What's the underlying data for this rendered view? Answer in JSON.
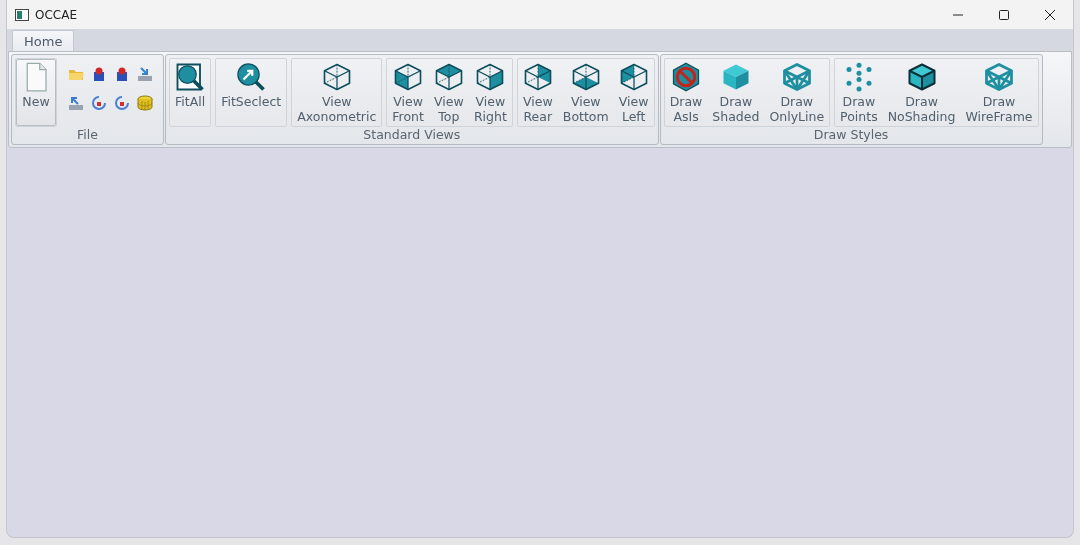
{
  "window": {
    "title": "OCCAE"
  },
  "tabs": [
    {
      "label": "Home",
      "selected": true
    }
  ],
  "ribbon": {
    "groups": [
      {
        "label": "File",
        "panels": [
          [
            {
              "kind": "large",
              "label": "New"
            }
          ],
          [
            {
              "kind": "small"
            },
            {
              "kind": "small"
            },
            {
              "kind": "small"
            },
            {
              "kind": "small"
            },
            {
              "kind": "small"
            },
            {
              "kind": "small"
            },
            {
              "kind": "small"
            },
            {
              "kind": "small"
            }
          ]
        ]
      },
      {
        "label": "Standard Views",
        "panels": [
          [
            {
              "kind": "large",
              "label": "FitAll"
            }
          ],
          [
            {
              "kind": "large",
              "label": "FitSeclect"
            }
          ],
          [
            {
              "kind": "large",
              "label": "View Axonometric"
            }
          ],
          [
            {
              "kind": "large",
              "label": "View Front"
            },
            {
              "kind": "large",
              "label": "View Top"
            },
            {
              "kind": "large",
              "label": "View Right"
            }
          ],
          [
            {
              "kind": "large",
              "label": "View Rear"
            },
            {
              "kind": "large",
              "label": "View Bottom"
            },
            {
              "kind": "large",
              "label": "View Left"
            }
          ]
        ]
      },
      {
        "label": "Draw Styles",
        "panels": [
          [
            {
              "kind": "large",
              "label": "Draw AsIs"
            },
            {
              "kind": "large",
              "label": "Draw Shaded"
            },
            {
              "kind": "large",
              "label": "Draw OnlyLine"
            }
          ],
          [
            {
              "kind": "large",
              "label": "Draw Points"
            },
            {
              "kind": "large",
              "label": "Draw NoShading"
            },
            {
              "kind": "large",
              "label": "Draw WireFrame"
            }
          ]
        ]
      }
    ]
  }
}
